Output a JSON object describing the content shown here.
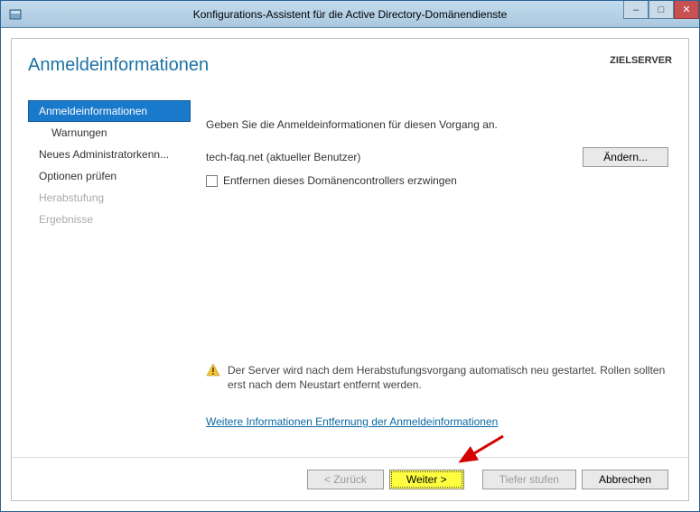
{
  "window": {
    "title": "Konfigurations-Assistent für die Active Directory-Domänendienste",
    "controls": {
      "minimize": "–",
      "maximize": "□",
      "close": "✕"
    }
  },
  "header": {
    "page_title": "Anmeldeinformationen",
    "target_label": "ZIELSERVER"
  },
  "sidebar": {
    "items": [
      {
        "label": "Anmeldeinformationen"
      },
      {
        "label": "Warnungen"
      },
      {
        "label": "Neues Administratorkenn..."
      },
      {
        "label": "Optionen prüfen"
      },
      {
        "label": "Herabstufung"
      },
      {
        "label": "Ergebnisse"
      }
    ]
  },
  "content": {
    "lead": "Geben Sie die Anmeldeinformationen für diesen Vorgang an.",
    "user": "tech-faq.net (aktueller Benutzer)",
    "change_button": "Ändern...",
    "checkbox_label": "Entfernen dieses Domänencontrollers erzwingen",
    "warning": "Der Server wird nach dem Herabstufungsvorgang automatisch neu gestartet. Rollen sollten erst nach dem Neustart entfernt werden.",
    "link": "Weitere Informationen Entfernung der Anmeldeinformationen"
  },
  "footer": {
    "back": "< Zurück",
    "next": "Weiter >",
    "demote": "Tiefer stufen",
    "cancel": "Abbrechen"
  }
}
